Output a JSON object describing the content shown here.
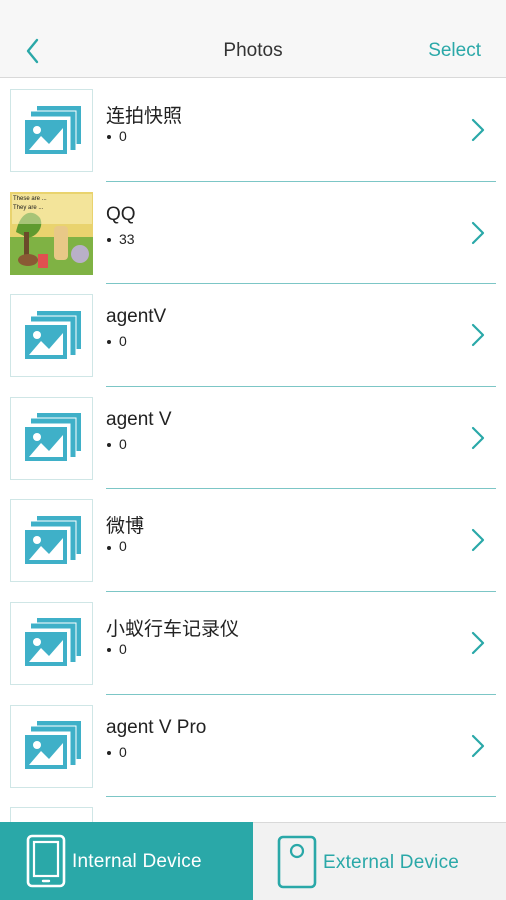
{
  "header": {
    "title": "Photos",
    "select_label": "Select",
    "back_icon": "chevron-left-icon"
  },
  "albums": [
    {
      "title": "连拍快照",
      "count": "0",
      "thumb": "placeholder"
    },
    {
      "title": "QQ",
      "count": "33",
      "thumb": "photo",
      "thumb_text_1": "These are ...",
      "thumb_text_2": "They are ..."
    },
    {
      "title": "agentV",
      "count": "0",
      "thumb": "placeholder"
    },
    {
      "title": "agent V",
      "count": "0",
      "thumb": "placeholder"
    },
    {
      "title": "微博",
      "count": "0",
      "thumb": "placeholder"
    },
    {
      "title": "小蚁行车记录仪",
      "count": "0",
      "thumb": "placeholder"
    },
    {
      "title": "agent V Pro",
      "count": "0",
      "thumb": "placeholder"
    },
    {
      "title": "",
      "count": "",
      "thumb": "placeholder"
    }
  ],
  "tabs": {
    "internal_label": "Internal Device",
    "external_label": "External Device",
    "active": "internal"
  },
  "colors": {
    "accent": "#2aa8a8",
    "divider": "#7cc6c6",
    "header_bg": "#f7f7f7"
  }
}
